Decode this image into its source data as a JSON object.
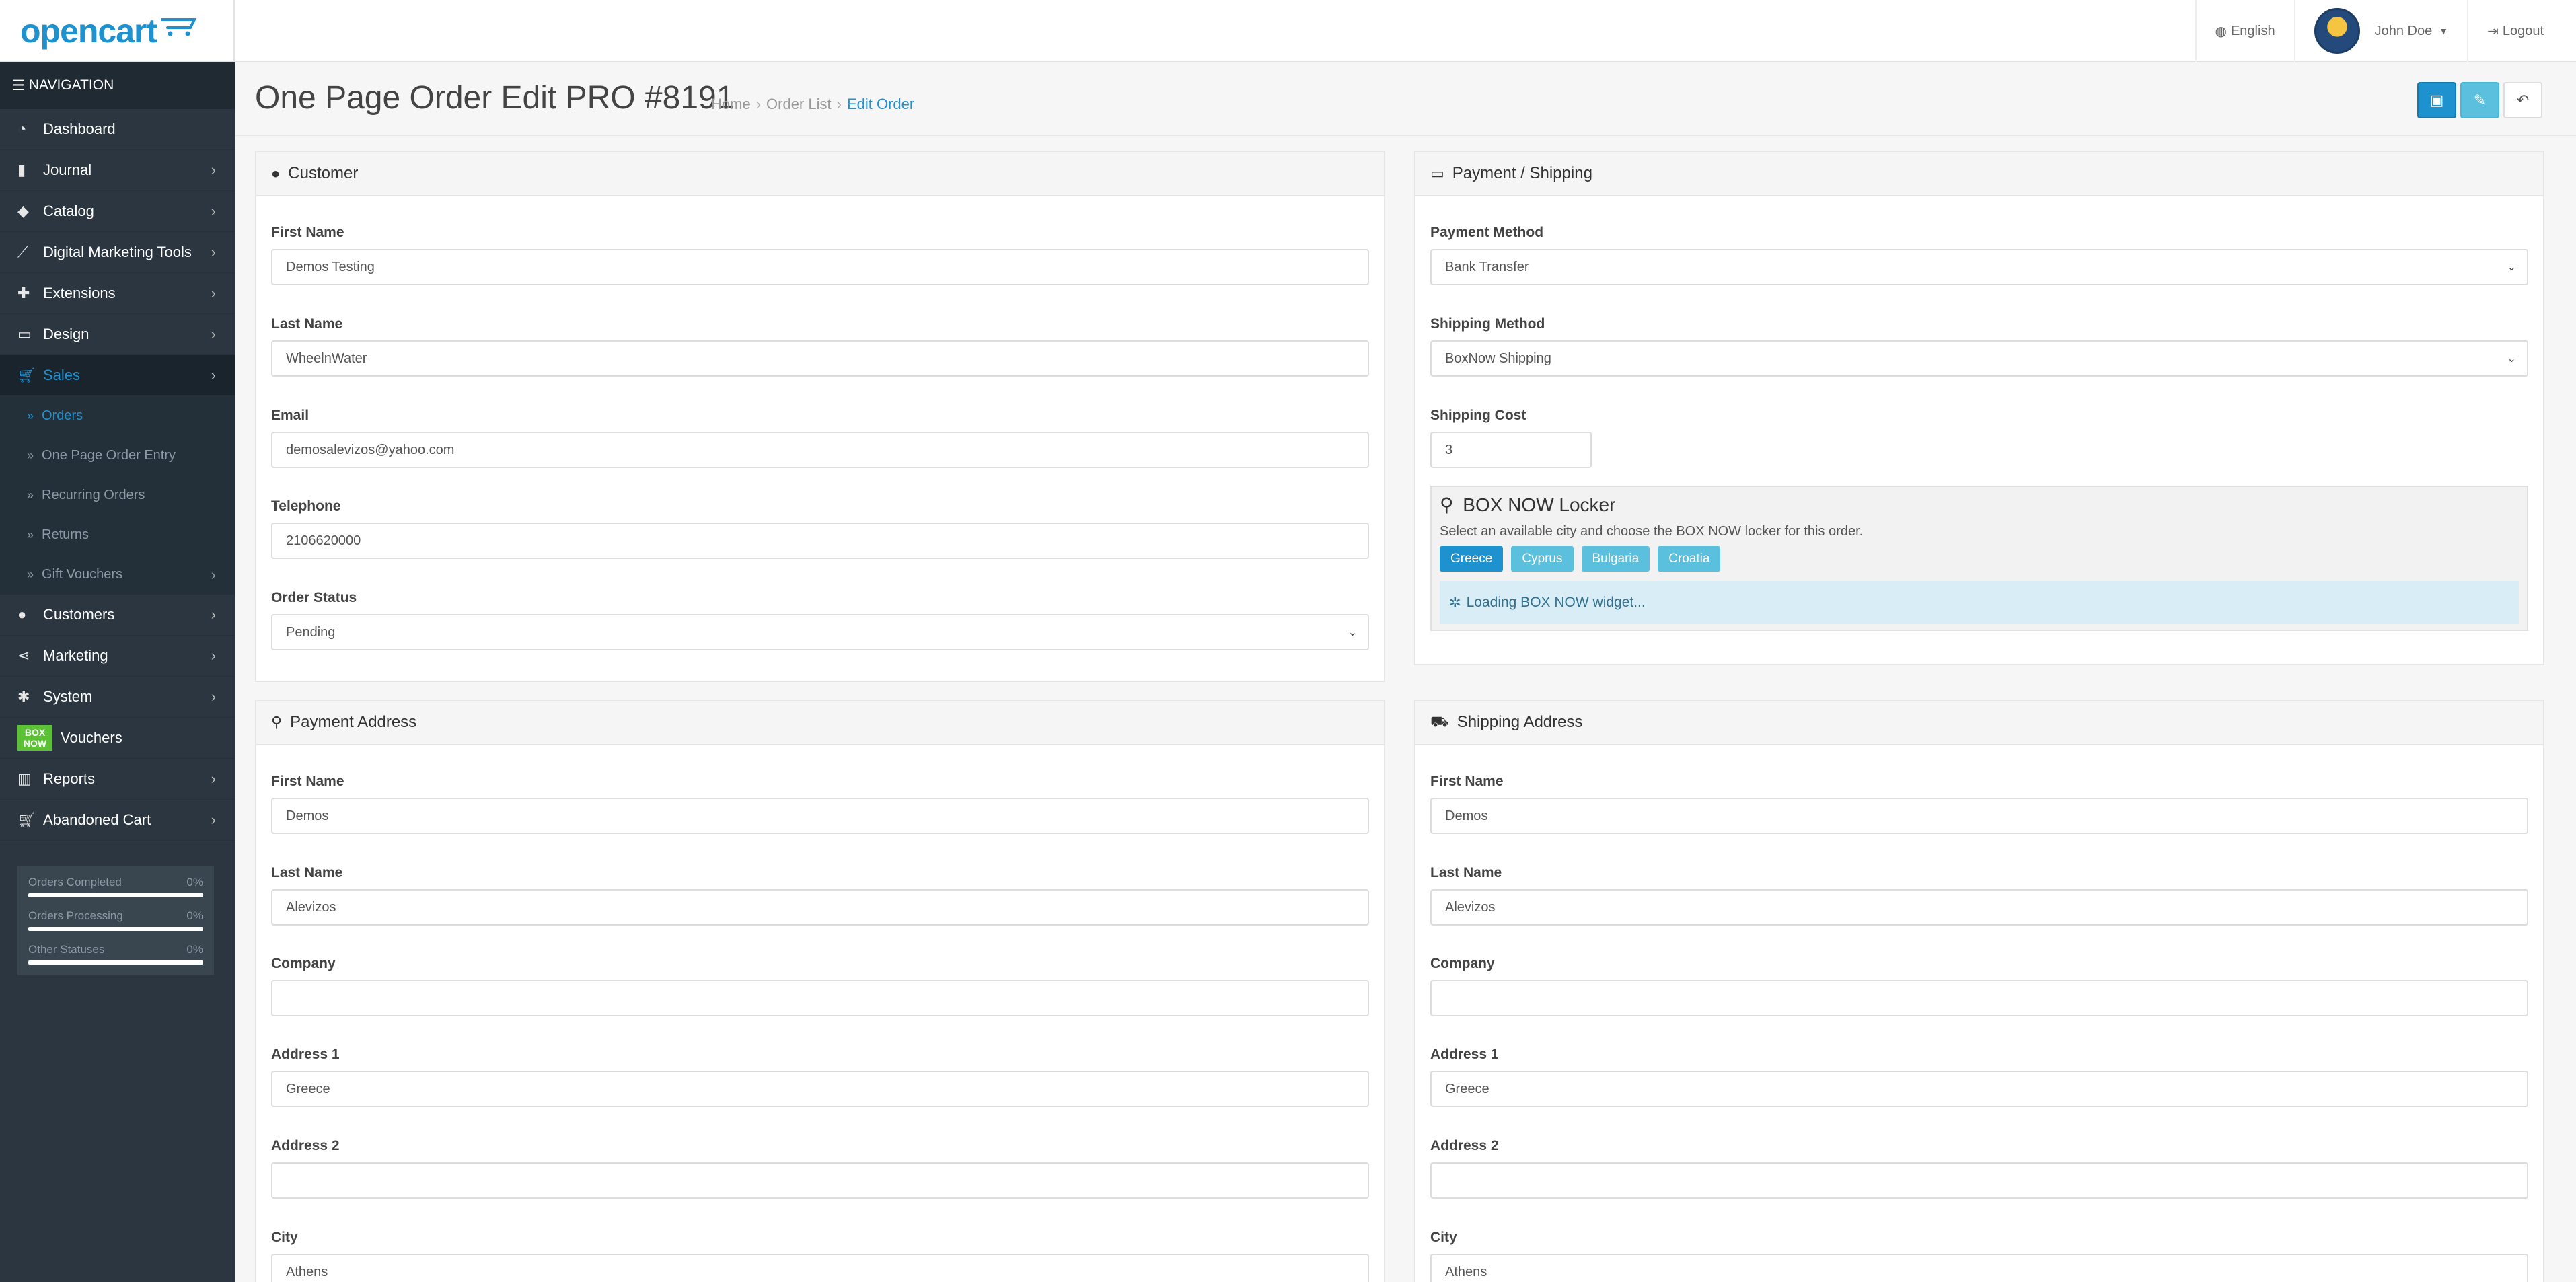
{
  "header": {
    "logo": "opencart",
    "language": "English",
    "user": "John Doe",
    "logout": "Logout"
  },
  "sidebar": {
    "nav_title": "NAVIGATION",
    "items": [
      {
        "label": "Dashboard",
        "icon": "dashboard-icon"
      },
      {
        "label": "Journal",
        "icon": "book-icon"
      },
      {
        "label": "Catalog",
        "icon": "tags-icon"
      },
      {
        "label": "Digital Marketing Tools",
        "icon": "chart-line-icon"
      },
      {
        "label": "Extensions",
        "icon": "puzzle-icon"
      },
      {
        "label": "Design",
        "icon": "monitor-icon"
      },
      {
        "label": "Sales",
        "icon": "shopping-cart-icon"
      },
      {
        "label": "Customers",
        "icon": "user-icon"
      },
      {
        "label": "Marketing",
        "icon": "share-icon"
      },
      {
        "label": "System",
        "icon": "cog-icon"
      },
      {
        "label": "Vouchers",
        "icon": "boxnow-icon"
      },
      {
        "label": "Reports",
        "icon": "bar-chart-icon"
      },
      {
        "label": "Abandoned Cart",
        "icon": "shopping-cart-icon"
      }
    ],
    "sales_sub": [
      "Orders",
      "One Page Order Entry",
      "Recurring Orders",
      "Returns",
      "Gift Vouchers"
    ],
    "boxnow_badge": [
      "BOX",
      "NOW"
    ],
    "stats": [
      {
        "label": "Orders Completed",
        "value": "0%"
      },
      {
        "label": "Orders Processing",
        "value": "0%"
      },
      {
        "label": "Other Statuses",
        "value": "0%"
      }
    ]
  },
  "page": {
    "title": "One Page Order Edit PRO #8191",
    "breadcrumb": [
      "Home",
      "Order List",
      "Edit Order"
    ],
    "separator": "›"
  },
  "customer": {
    "heading": "Customer",
    "first_name_label": "First Name",
    "first_name": "Demos Testing",
    "last_name_label": "Last Name",
    "last_name": "WheelnWater",
    "email_label": "Email",
    "email": "demosalevizos@yahoo.com",
    "telephone_label": "Telephone",
    "telephone": "2106620000",
    "status_label": "Order Status",
    "status": "Pending"
  },
  "payment_shipping": {
    "heading": "Payment / Shipping",
    "payment_method_label": "Payment Method",
    "payment_method": "Bank Transfer",
    "shipping_method_label": "Shipping Method",
    "shipping_method": "BoxNow Shipping",
    "shipping_cost_label": "Shipping Cost",
    "shipping_cost": "3",
    "boxnow_title": "BOX NOW Locker",
    "boxnow_desc": "Select an available city and choose the BOX NOW locker for this order.",
    "countries": [
      "Greece",
      "Cyprus",
      "Bulgaria",
      "Croatia"
    ],
    "loading": "Loading BOX NOW widget..."
  },
  "payment_address": {
    "heading": "Payment Address",
    "first_name_label": "First Name",
    "first_name": "Demos",
    "last_name_label": "Last Name",
    "last_name": "Alevizos",
    "company_label": "Company",
    "company": "",
    "address1_label": "Address 1",
    "address1": "Greece",
    "address2_label": "Address 2",
    "address2": "",
    "city_label": "City",
    "city": "Athens"
  },
  "shipping_address": {
    "heading": "Shipping Address",
    "first_name_label": "First Name",
    "first_name": "Demos",
    "last_name_label": "Last Name",
    "last_name": "Alevizos",
    "company_label": "Company",
    "company": "",
    "address1_label": "Address 1",
    "address1": "Greece",
    "address2_label": "Address 2",
    "address2": "",
    "city_label": "City",
    "city": "Athens"
  },
  "colors": {
    "accent": "#1e91cf",
    "info": "#5bc0de",
    "sidebar": "#2b3641",
    "boxnow": "#5bc236"
  }
}
